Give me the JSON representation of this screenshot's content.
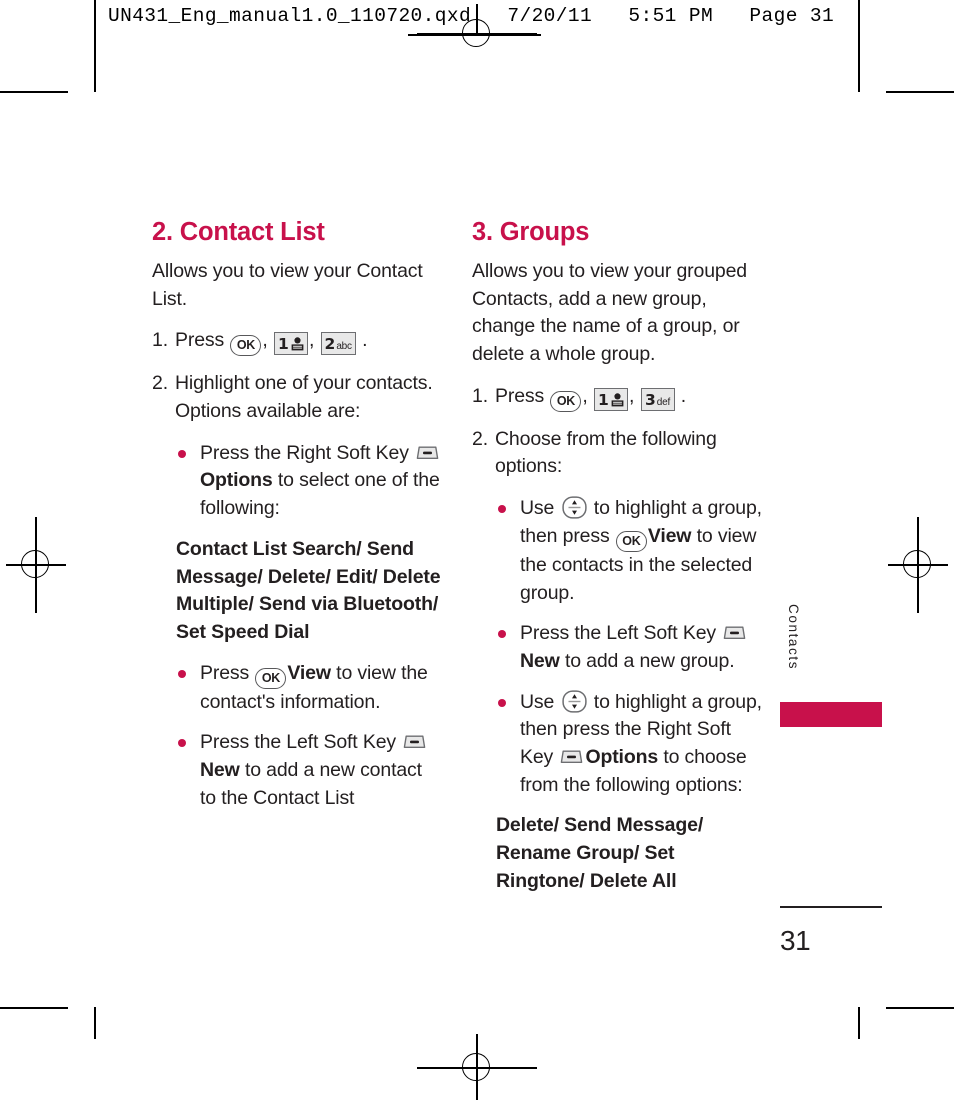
{
  "prepress": {
    "header_text": "UN431_Eng_manual1.0_110720.qxd   7/20/11   5:51 PM   Page 31"
  },
  "side_tab": {
    "label": "Contacts",
    "accent_color": "#c8114b"
  },
  "page": {
    "number": "31"
  },
  "left_column": {
    "title": "2. Contact List",
    "intro": "Allows you to view your Contact List.",
    "step1": {
      "num": "1.",
      "text_before": "Press",
      "key_ok": "OK",
      "comma1": ",",
      "key_1_digit": "1",
      "comma2": ",",
      "key_2_digit": "2",
      "key_2_letters": "abc",
      "period": "."
    },
    "step2": {
      "num": "2.",
      "text": "Highlight one of your contacts. Options available are:"
    },
    "bullets": [
      {
        "part1": "Press the Right Soft Key",
        "softkey_label": "Options",
        "part2": "to select one of the following:"
      },
      {
        "part1": "Press",
        "ok_label": "View",
        "part2": "to view the contact's information."
      },
      {
        "part1": "Press the Left Soft Key",
        "softkey_label": "New",
        "part2": "to add a new contact to the Contact List"
      }
    ],
    "options_list": "Contact List Search/ Send Message/ Delete/ Edit/ Delete Multiple/ Send via Bluetooth/ Set Speed Dial"
  },
  "right_column": {
    "title": "3. Groups",
    "intro": "Allows you to view your grouped Contacts, add a new group, change the name of a group, or delete a whole group.",
    "step1": {
      "num": "1.",
      "text_before": "Press",
      "key_ok": "OK",
      "comma1": ",",
      "key_1_digit": "1",
      "comma2": ",",
      "key_3_digit": "3",
      "key_3_letters": "def",
      "period": "."
    },
    "step2": {
      "num": "2.",
      "text": "Choose from the following options:"
    },
    "bullets": [
      {
        "part1": "Use",
        "part2": "to highlight a group, then press",
        "ok_label": "View",
        "part3": "to view the contacts in the selected group."
      },
      {
        "part1": "Press the Left Soft Key",
        "softkey_label": "New",
        "part2": "to add a new group."
      },
      {
        "part1": "Use",
        "part2": "to highlight a group, then press the Right Soft Key",
        "softkey_label": "Options",
        "part3": "to choose from the following options:"
      }
    ],
    "options_list": "Delete/ Send Message/ Rename Group/ Set Ringtone/ Delete All"
  }
}
